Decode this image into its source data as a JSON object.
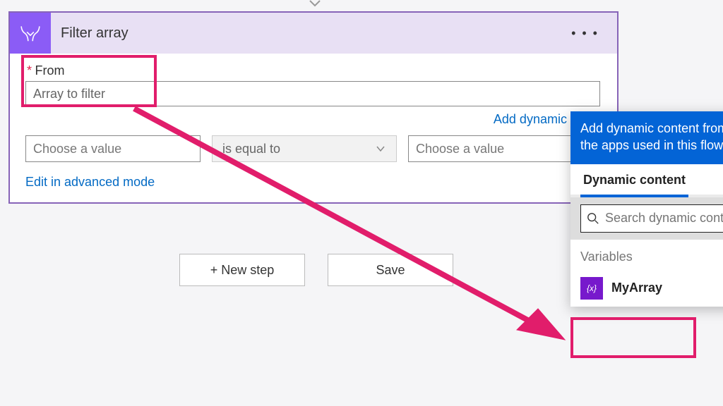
{
  "action": {
    "title": "Filter array",
    "from_label": "From",
    "from_placeholder": "Array to filter",
    "dynamic_content_link": "Add dynamic conte",
    "condition": {
      "left_placeholder": "Choose a value",
      "op": "is equal to",
      "right_placeholder": "Choose a value"
    },
    "advanced_link": "Edit in advanced mode"
  },
  "footer": {
    "new_step": "+ New step",
    "save": "Save"
  },
  "dynamic_panel": {
    "banner": "Add dynamic content from the apps used in this flow.",
    "tabs": {
      "dynamic": "Dynamic content"
    },
    "search_placeholder": "Search dynamic content",
    "section": "Variables",
    "item_label": "MyArray",
    "item_glyph": "{x}"
  }
}
